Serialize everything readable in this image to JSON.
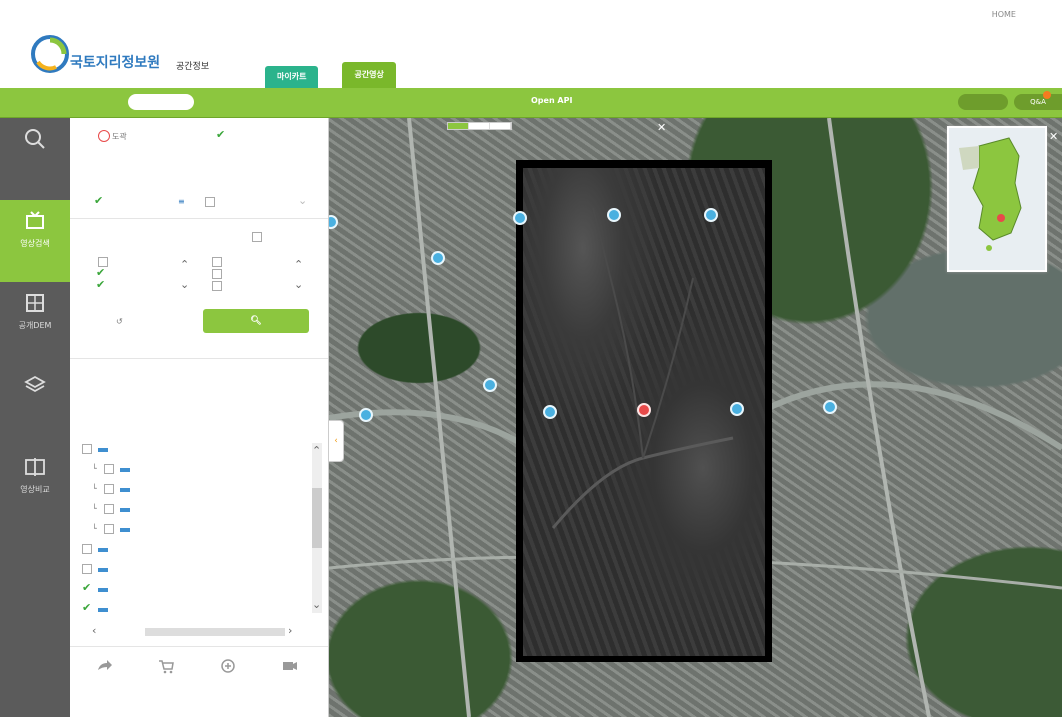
{
  "header": {
    "util_links": [
      "",
      "HOME",
      "",
      "",
      ""
    ],
    "org_small": "",
    "org_name": "국토지리정보원",
    "org_sub": "공간정보",
    "tabs": [
      {
        "label": "마이카트",
        "kind": "mycart"
      },
      {
        "label": "",
        "kind": "normal"
      },
      {
        "label": "공간영상",
        "kind": "active"
      },
      {
        "label": "",
        "kind": "normal"
      },
      {
        "label": "",
        "kind": "normal"
      },
      {
        "label": "",
        "kind": "normal"
      },
      {
        "label": "",
        "kind": "normal"
      },
      {
        "label": "",
        "kind": "normal"
      }
    ]
  },
  "greennav": {
    "title": "",
    "pill": "",
    "items": [
      "",
      "",
      "",
      "Open API"
    ],
    "notice": "",
    "qa": "Q&A"
  },
  "sidebar": {
    "items": [
      {
        "label": "",
        "icon": "search-icon",
        "active": false
      },
      {
        "label": "영상검색",
        "icon": "image-search-icon",
        "active": true
      },
      {
        "label": "공개DEM",
        "icon": "dem-grid-icon",
        "active": false
      },
      {
        "label": "",
        "icon": "layers-icon",
        "active": false
      },
      {
        "label": "영상비교",
        "icon": "compare-icon",
        "active": false
      }
    ]
  },
  "panel": {
    "opt_left": "도곽",
    "opt_right": "",
    "type_prompt": "",
    "type_selected": "",
    "type_extra": "",
    "year_prompt": "",
    "select_all": "",
    "decades": [
      {
        "label": "",
        "checked": false
      },
      {
        "label": "",
        "checked": true
      },
      {
        "label": "",
        "checked": true
      }
    ],
    "years": [
      "",
      "",
      ""
    ],
    "reset_label": "",
    "search_label": "",
    "results_title": "",
    "results_count": "",
    "expand_all": "",
    "collapse_all": "",
    "tree": [
      {
        "label": "",
        "checked": false,
        "indent": 0
      },
      {
        "label": "",
        "checked": false,
        "indent": 1
      },
      {
        "label": "",
        "checked": false,
        "indent": 1
      },
      {
        "label": "",
        "checked": false,
        "indent": 1
      },
      {
        "label": "",
        "checked": false,
        "indent": 1
      },
      {
        "label": "",
        "checked": false,
        "indent": 0
      },
      {
        "label": "",
        "checked": false,
        "indent": 0
      },
      {
        "label": "",
        "checked": true,
        "indent": 0
      },
      {
        "label": "",
        "checked": true,
        "indent": 0
      }
    ],
    "bottom_buttons": [
      "",
      "",
      "",
      ""
    ]
  },
  "map": {
    "tabs": [
      {
        "label": "",
        "active": true
      },
      {
        "label": "",
        "active": false
      },
      {
        "label": "",
        "active": false
      }
    ]
  },
  "colors": {
    "accent": "#8cc63f",
    "sidebar": "#5b5b5b",
    "active_tab": "#7ab82b",
    "mycart": "#2bb38c"
  }
}
